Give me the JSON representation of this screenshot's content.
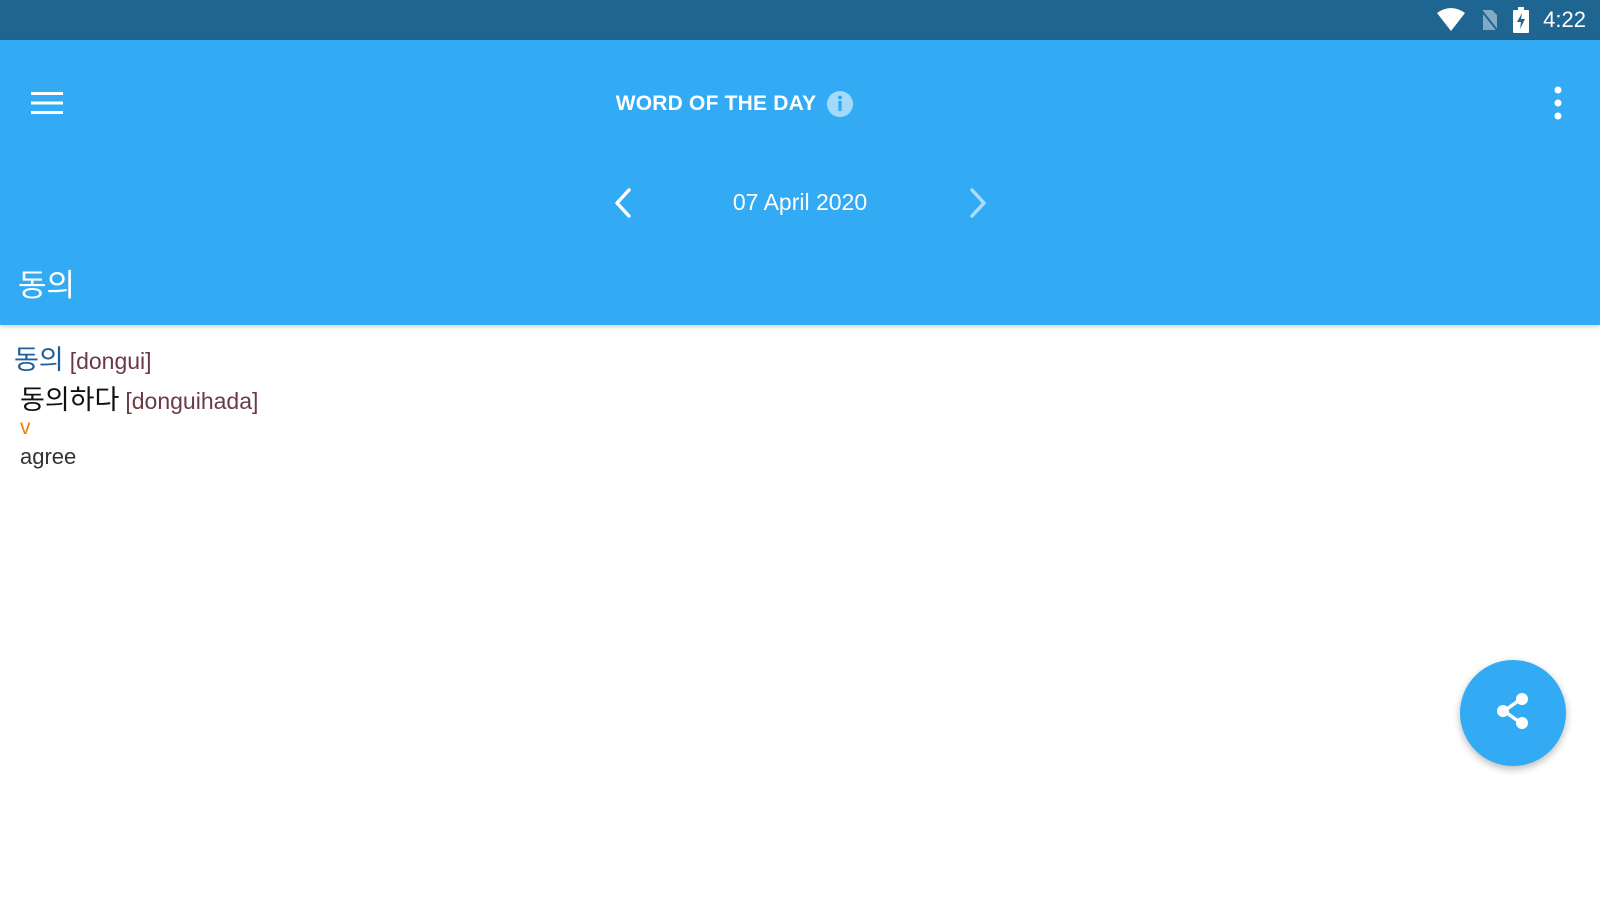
{
  "status_bar": {
    "time": "4:22",
    "icons": [
      "wifi-icon",
      "no-sim-icon",
      "battery-charging-icon"
    ]
  },
  "app_bar": {
    "title": "WORD OF THE DAY",
    "date": "07 April 2020",
    "word": "동의",
    "icons": {
      "menu": "menu-icon",
      "info": "info-icon",
      "overflow": "more-vert-icon",
      "prev": "chevron-left-icon",
      "next": "chevron-right-icon"
    }
  },
  "entry": {
    "headword": "동의",
    "headword_romanization": "[dongui]",
    "derived": "동의하다",
    "derived_romanization": "[donguihada]",
    "part_of_speech": "v",
    "definition": "agree"
  },
  "fab": {
    "icon": "share-icon"
  },
  "colors": {
    "status_bar": "#1f6592",
    "primary": "#33aaf4",
    "headword": "#1f5f9a",
    "romanization": "#6b3a45",
    "part_of_speech": "#f0800a"
  }
}
